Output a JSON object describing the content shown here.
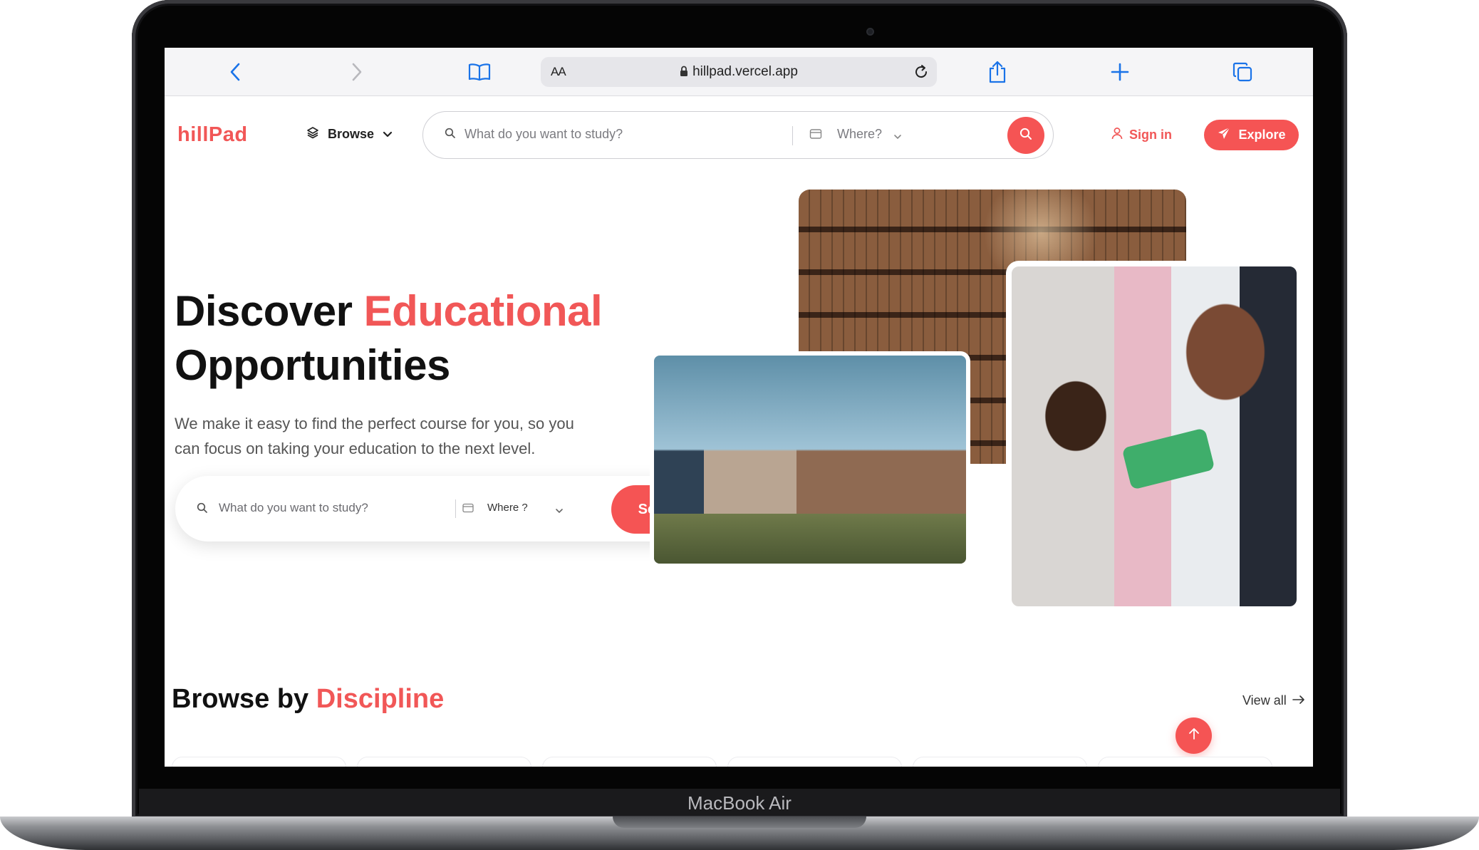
{
  "device": {
    "label": "MacBook Air"
  },
  "browser": {
    "text_size_label": "AA",
    "url": "hillpad.vercel.app",
    "icons": [
      "back-icon",
      "forward-icon",
      "bookmarks-icon",
      "lock-icon",
      "reload-icon",
      "share-icon",
      "new-tab-icon",
      "tabs-icon"
    ]
  },
  "header": {
    "logo": "hillPad",
    "browse_label": "Browse",
    "search_placeholder": "What do you want to study?",
    "where_placeholder": "Where?",
    "signin_label": "Sign in",
    "explore_label": "Explore"
  },
  "hero": {
    "title_part1": "Discover ",
    "title_accent": "Educational",
    "title_part2": "Opportunities",
    "subtitle": "We make it easy to find the perfect course for you, so you can focus on taking your education to the next level.",
    "search_placeholder": "What do you want to study?",
    "where_placeholder": "Where ?",
    "search_button": "Search"
  },
  "disciplines": {
    "title_part1": "Browse by ",
    "title_accent": "Discipline",
    "view_all": "View all"
  },
  "colors": {
    "accent": "#f15757",
    "button": "#f55454"
  }
}
